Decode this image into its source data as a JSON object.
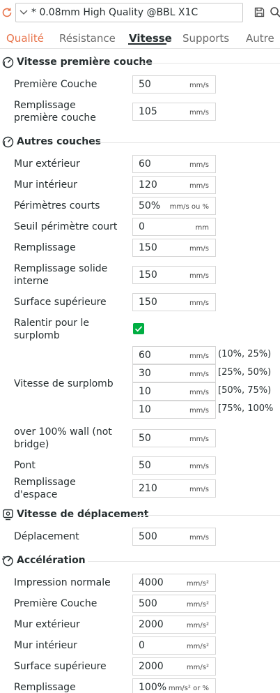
{
  "colors": {
    "accent": "#00ae42",
    "tab_orange": "#e8734a"
  },
  "preset": {
    "name": "* 0.08mm High Quality @BBL X1C"
  },
  "icons": {
    "sync": "sync-icon",
    "chevron": "chevron-down-icon",
    "save": "save-icon",
    "search": "search-icon"
  },
  "tabs": [
    {
      "label": "Qualité"
    },
    {
      "label": "Résistance"
    },
    {
      "label": "Vitesse",
      "active": true
    },
    {
      "label": "Supports"
    },
    {
      "label": "Autre"
    }
  ],
  "sections": {
    "first_layer": {
      "title": "Vitesse première couche",
      "rows": {
        "first_layer": {
          "label": "Première Couche",
          "value": "50",
          "unit": "mm/s"
        },
        "first_layer_infill": {
          "label_line1": "Remplissage",
          "label_line2": "première couche",
          "value": "105",
          "unit": "mm/s"
        }
      }
    },
    "other_layers": {
      "title": "Autres couches",
      "rows": {
        "outer_wall": {
          "label": "Mur extérieur",
          "value": "60",
          "unit": "mm/s"
        },
        "inner_wall": {
          "label": "Mur intérieur",
          "value": "120",
          "unit": "mm/s"
        },
        "small_perimeters": {
          "label": "Périmètres courts",
          "value": "50%",
          "unit": "mm/s ou %"
        },
        "small_perimeter_threshold": {
          "label": "Seuil périmètre court",
          "value": "0",
          "unit": "mm"
        },
        "sparse_infill": {
          "label": "Remplissage",
          "value": "150",
          "unit": "mm/s"
        },
        "internal_solid_infill": {
          "label_line1": "Remplissage solide",
          "label_line2": "interne",
          "value": "150",
          "unit": "mm/s"
        },
        "top_surface": {
          "label": "Surface supérieure",
          "value": "150",
          "unit": "mm/s"
        },
        "slow_down_overhang": {
          "label_line1": "Ralentir pour le",
          "label_line2": "surplomb",
          "checked": true
        },
        "overhang_speed": {
          "label": "Vitesse de surplomb",
          "entries": [
            {
              "value": "60",
              "unit": "mm/s",
              "range": "(10%, 25%)"
            },
            {
              "value": "30",
              "unit": "mm/s",
              "range": "[25%, 50%)"
            },
            {
              "value": "10",
              "unit": "mm/s",
              "range": "[50%, 75%)"
            },
            {
              "value": "10",
              "unit": "mm/s",
              "range": "[75%, 100%"
            }
          ]
        },
        "over_100_wall": {
          "label_line1": "over 100% wall (not",
          "label_line2": "bridge)",
          "value": "50",
          "unit": "mm/s"
        },
        "bridge": {
          "label": "Pont",
          "value": "50",
          "unit": "mm/s"
        },
        "gap_infill": {
          "label_line1": "Remplissage",
          "label_line2": "d'espace",
          "value": "210",
          "unit": "mm/s"
        }
      }
    },
    "travel": {
      "title": "Vitesse de déplacement",
      "rows": {
        "travel": {
          "label": "Déplacement",
          "value": "500",
          "unit": "mm/s"
        }
      }
    },
    "acceleration": {
      "title": "Accélération",
      "rows": {
        "normal_printing": {
          "label": "Impression normale",
          "value": "4000",
          "unit": "mm/s²"
        },
        "first_layer": {
          "label": "Première Couche",
          "value": "500",
          "unit": "mm/s²"
        },
        "outer_wall": {
          "label": "Mur extérieur",
          "value": "2000",
          "unit": "mm/s²"
        },
        "inner_wall": {
          "label": "Mur intérieur",
          "value": "0",
          "unit": "mm/s²"
        },
        "top_surface": {
          "label": "Surface supérieure",
          "value": "2000",
          "unit": "mm/s²"
        },
        "sparse_infill": {
          "label": "Remplissage",
          "value": "100%",
          "unit": "mm/s² or %"
        }
      }
    }
  }
}
